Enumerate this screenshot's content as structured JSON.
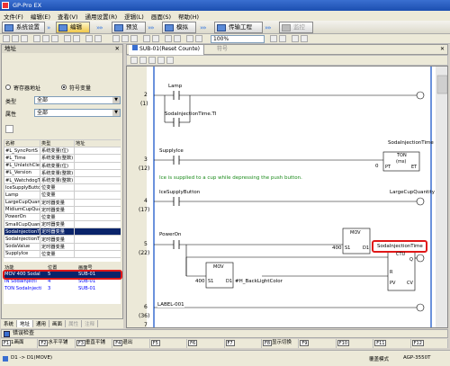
{
  "app": {
    "title": "GP-Pro EX"
  },
  "menu": [
    "文件(F)",
    "编辑(E)",
    "查看(V)",
    "通用设置(R)",
    "逻辑(L)",
    "画面(S)",
    "帮助(H)"
  ],
  "mainbar": {
    "system_settings": "系统设置",
    "edit": "编辑",
    "preview": "预览",
    "simulate": "模拟",
    "transfer": "传输工程",
    "monitor": "监控"
  },
  "toolbar": {
    "zoom": "100%"
  },
  "address_pane": {
    "title": "地址",
    "register_address": "寄存器地址",
    "symbol_variable": "符号变量",
    "type_label": "类型",
    "type_value": "全部",
    "attr_label": "属性",
    "attr_value": "全部"
  },
  "symbol_table": {
    "headers": [
      "名称",
      "类型",
      "地址"
    ],
    "rows": [
      [
        "#L_SyncPortS",
        "系统变量(位)",
        ""
      ],
      [
        "#L_Time",
        "系统变量(整数)",
        ""
      ],
      [
        "#L_UnlatchCle",
        "系统变量(位)",
        ""
      ],
      [
        "#L_Version",
        "系统变量(整数)",
        ""
      ],
      [
        "#L_WatchdogT",
        "系统变量(整数)",
        ""
      ],
      [
        "IceSupplyButton",
        "位变量",
        ""
      ],
      [
        "Lamp",
        "位变量",
        ""
      ],
      [
        "LargeCupQuan",
        "定时器变量",
        ""
      ],
      [
        "MidiumCupQuan",
        "定时器变量",
        ""
      ],
      [
        "PowerOn",
        "位变量",
        ""
      ],
      [
        "SmallCupQuant",
        "定时器变量",
        ""
      ],
      [
        "SodaInjectionT",
        "定时器变量",
        ""
      ],
      [
        "SodaInjectionTi",
        "定时器变量",
        ""
      ],
      [
        "SodaValue",
        "定时器变量",
        ""
      ],
      [
        "SupplyIce",
        "位变量",
        ""
      ]
    ],
    "highlight_index": 11
  },
  "ref_table": {
    "headers": [
      "功能",
      "位置",
      "画面号"
    ],
    "rows": [
      [
        "MOV 400 SodaI",
        "5",
        "SUB-01"
      ],
      [
        "IN SodaInjecti",
        "4",
        "SUB-01"
      ],
      [
        "TON SodaInjecti",
        "3",
        "SUB-01"
      ]
    ]
  },
  "left_tabs": [
    "系统",
    "地址",
    "通用",
    "画面",
    "属性",
    "注释"
  ],
  "editor": {
    "tab_title": "SUB-01(Reset Counte)",
    "tab2": "符号"
  },
  "ladder": {
    "rungs": [
      {
        "num": "2",
        "sub": "(1)",
        "contacts": [
          "Lamp",
          "SodaInjectionTime.TI"
        ]
      },
      {
        "num": "3",
        "sub": "(12)",
        "contact": "SupplyIce",
        "coil": "SodaInjectionTime",
        "comment": "Ice is supplied to a cup while depressing the push button.",
        "timer": {
          "name": "TON",
          "unit": "(ms)",
          "pt": "0",
          "pt_label": "PT",
          "et_label": "ET"
        }
      },
      {
        "num": "4",
        "sub": "(17)",
        "contact": "IceSupplyButton",
        "coil": "LargeCupQuantity"
      },
      {
        "num": "5",
        "sub": "(22)",
        "contact": "PowerOn",
        "mov1": {
          "name": "MOV",
          "s1": "S1",
          "d1": "D1",
          "src": "400",
          "dst": "SodaInjectionTime"
        },
        "mov2": {
          "name": "MOV",
          "s1": "S1",
          "d1": "D1",
          "src": "400",
          "dst": "#H_BackLightColor"
        },
        "ctu": {
          "name": "CTU",
          "q": "Q",
          "r": "R",
          "pv": "PV",
          "cv": "CV"
        }
      },
      {
        "num": "6",
        "sub": "(36)",
        "label": "LABEL-001"
      },
      {
        "num": "7",
        "sub": ""
      }
    ]
  },
  "error_bar": {
    "label": "错误检查"
  },
  "fkeys": [
    {
      "key": "F1",
      "label": "1画面"
    },
    {
      "key": "F2",
      "label": "水平平铺"
    },
    {
      "key": "F3",
      "label": "垂直平铺"
    },
    {
      "key": "F4",
      "label": "退出"
    },
    {
      "key": "F5",
      "label": ""
    },
    {
      "key": "F6",
      "label": ""
    },
    {
      "key": "F7",
      "label": ""
    },
    {
      "key": "F8",
      "label": "显示切换"
    },
    {
      "key": "F9",
      "label": ""
    },
    {
      "key": "F10",
      "label": ""
    },
    {
      "key": "F11",
      "label": ""
    },
    {
      "key": "F12",
      "label": ""
    }
  ],
  "status": {
    "position": "D1 -> D1(MOVE)",
    "mode": "覆盖模式",
    "model": "AGP-3550T"
  }
}
